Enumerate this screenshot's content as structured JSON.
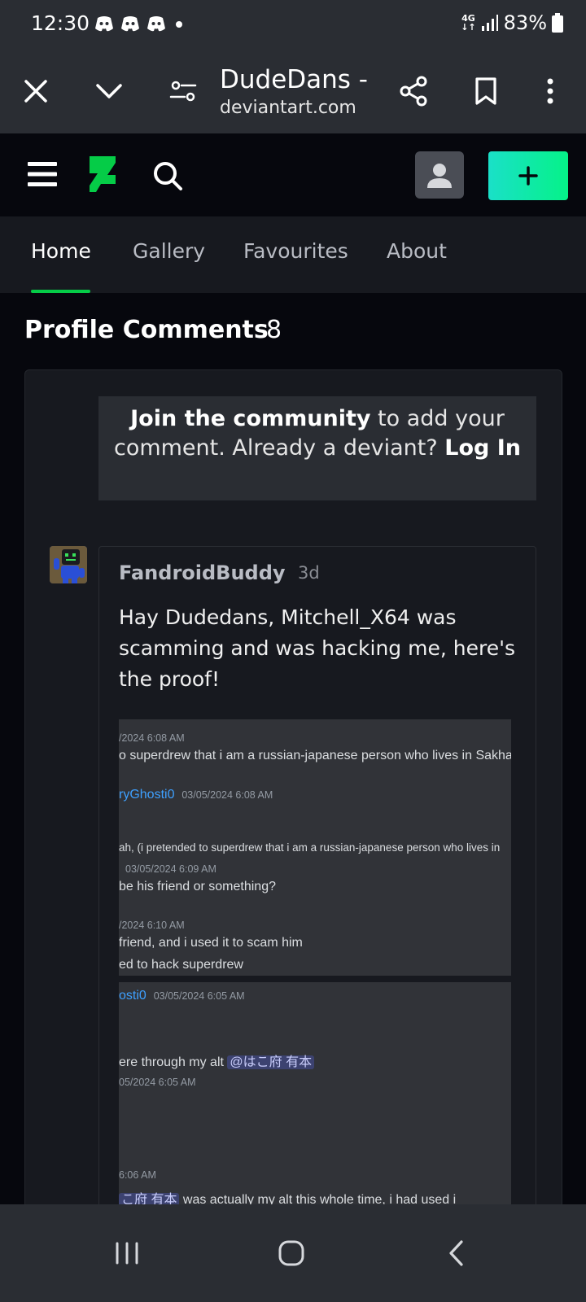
{
  "status_bar": {
    "time": "12:30",
    "network": "4G",
    "battery": "83%",
    "notification_icons": [
      "discord-icon",
      "discord-icon",
      "discord-icon"
    ]
  },
  "browser": {
    "page_title": "DudeDans - ...",
    "domain": "deviantart.com",
    "buttons": [
      "close-icon",
      "chevron-down-icon",
      "site-settings-icon",
      "share-icon",
      "bookmark-icon",
      "more-vert-icon"
    ]
  },
  "header": {
    "buttons": [
      "menu-icon",
      "deviantart-logo",
      "search-icon",
      "avatar-icon",
      "plus-icon"
    ],
    "accent": "#05cc47"
  },
  "tabs": {
    "items": [
      {
        "label": "Home",
        "active": true
      },
      {
        "label": "Gallery",
        "active": false
      },
      {
        "label": "Favourites",
        "active": false
      },
      {
        "label": "About",
        "active": false
      }
    ]
  },
  "comments": {
    "title": "Profile Comments",
    "count": "8",
    "join": {
      "link": "Join the community",
      "text": " to add your comment. Already a deviant? ",
      "login": "Log In"
    },
    "items": [
      {
        "user": "FandroidBuddy",
        "time": "3d",
        "text": "Hay Dudedans, Mitchell_X64 was scamming and was hacking me, here's the proof!",
        "screenshot": {
          "lines1": [
            {
              "kind": "ts",
              "text": "/2024 6:08 AM"
            },
            {
              "kind": "msg",
              "text": "o superdrew that i am a russian-japanese person who lives in Sakha"
            },
            {
              "kind": "name",
              "name": "ryGhosti0",
              "ts": "03/05/2024 6:08 AM"
            },
            {
              "kind": "msg",
              "text": "ah, (i pretended to superdrew that i am a russian-japanese person who lives in"
            },
            {
              "kind": "ts",
              "text": "03/05/2024 6:09 AM"
            },
            {
              "kind": "msg",
              "text": "be his friend or something?"
            },
            {
              "kind": "ts",
              "text": "/2024 6:10 AM"
            },
            {
              "kind": "msg",
              "text": "friend, and i used it to scam him"
            },
            {
              "kind": "msg",
              "text": "ed to hack superdrew"
            }
          ],
          "lines2": [
            {
              "kind": "name",
              "name": "osti0",
              "ts": "03/05/2024 6:05 AM"
            },
            {
              "kind": "msg",
              "text": "ere through my alt ",
              "mention": "@はこ府 有本"
            },
            {
              "kind": "ts",
              "text": "05/2024 6:05 AM"
            },
            {
              "kind": "ts",
              "text": "6:06 AM"
            },
            {
              "kind": "msg",
              "mention": "こ府 有本",
              "text": " was actually my alt this whole time, i had used i"
            }
          ]
        }
      }
    ]
  },
  "nav_bar": {
    "buttons": [
      "recents-icon",
      "home-icon",
      "back-icon"
    ]
  }
}
